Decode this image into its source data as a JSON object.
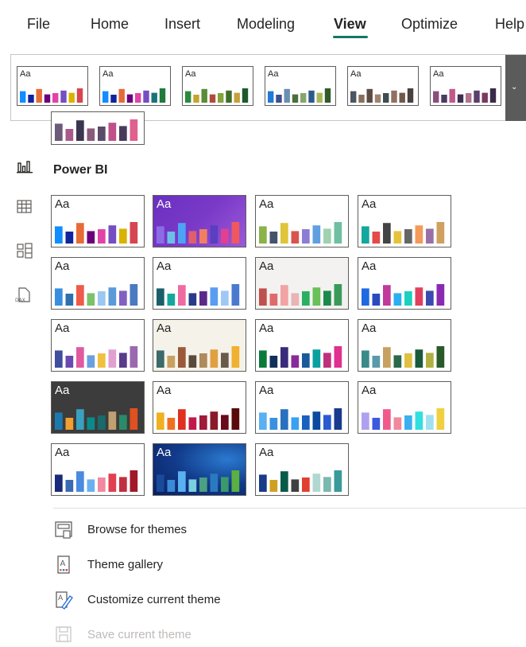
{
  "tabs": [
    {
      "label": "File",
      "active": false
    },
    {
      "label": "Home",
      "active": false
    },
    {
      "label": "Insert",
      "active": false
    },
    {
      "label": "Modeling",
      "active": false
    },
    {
      "label": "View",
      "active": true
    },
    {
      "label": "Optimize",
      "active": false
    },
    {
      "label": "Help",
      "active": false
    }
  ],
  "accent_color": "#117865",
  "aa_label": "Aa",
  "section_title": "Power BI",
  "ribbon_themes": [
    {
      "bars": [
        "#118dff",
        "#12239e",
        "#e66c37",
        "#6b007b",
        "#e044a7",
        "#744ec2",
        "#d9b300",
        "#d64550"
      ]
    },
    {
      "bars": [
        "#118dff",
        "#12239e",
        "#e66c37",
        "#6b007b",
        "#e044a7",
        "#744ec2",
        "#197278",
        "#1e7b3c"
      ]
    },
    {
      "bars": [
        "#2b8a3e",
        "#c6a32b",
        "#5b8c3a",
        "#b24a3c",
        "#84a33b",
        "#3f6e2a",
        "#c7a03a",
        "#1c5a2b"
      ]
    },
    {
      "bars": [
        "#1f7bd4",
        "#3f4e8c",
        "#6a8fb0",
        "#4c6e3d",
        "#85a76b",
        "#2d5a8c",
        "#a7b85b",
        "#325b2b"
      ]
    },
    {
      "bars": [
        "#4b5660",
        "#8a6e5c",
        "#5c4b42",
        "#a08470",
        "#3d4d52",
        "#907060",
        "#6f5a4a",
        "#4a4040"
      ]
    },
    {
      "bars": [
        "#8a4f7d",
        "#4b3b63",
        "#c05a8d",
        "#3d2f52",
        "#b4738d",
        "#5b3f6b",
        "#7a3860",
        "#3a2b4a"
      ]
    }
  ],
  "partial_theme": {
    "bars": [
      "#6b5a7a",
      "#a85a8a",
      "#3a3550",
      "#8a5a7a",
      "#5b4a6a",
      "#c0508a",
      "#4a3a5a",
      "#e06090"
    ]
  },
  "themes": [
    {
      "name": "default",
      "bg": "#ffffff",
      "aa": "#252423",
      "bars": [
        "#118dff",
        "#12239e",
        "#e66c37",
        "#6b007b",
        "#e044a7",
        "#744ec2",
        "#d9b300",
        "#d64550"
      ]
    },
    {
      "name": "purple",
      "bg": "grad-purple",
      "aa": "#ffffff",
      "bars": [
        "#8c6ce6",
        "#6cc0e6",
        "#4da3f5",
        "#e05f6d",
        "#f08060",
        "#5a3fc0",
        "#e04090",
        "#f05860"
      ]
    },
    {
      "name": "natural",
      "bg": "#ffffff",
      "aa": "#252423",
      "bars": [
        "#8ab348",
        "#44546a",
        "#e0c43a",
        "#d9534f",
        "#8c7cd6",
        "#60a0e0",
        "#9fd2ae",
        "#6fc0a0"
      ]
    },
    {
      "name": "teal",
      "bg": "#ffffff",
      "aa": "#252423",
      "bars": [
        "#12a89d",
        "#e44a4a",
        "#444444",
        "#e6c23a",
        "#666666",
        "#f49a5a",
        "#9a6fa8",
        "#d0a060"
      ]
    },
    {
      "name": "frontier",
      "bg": "#ffffff",
      "aa": "#252423",
      "bars": [
        "#3a8ee0",
        "#2f6fb0",
        "#ef5a4a",
        "#7cc26a",
        "#9ac8f0",
        "#5a9ad8",
        "#8060c0",
        "#4a7ac0"
      ]
    },
    {
      "name": "city",
      "bg": "#ffffff",
      "aa": "#252423",
      "bars": [
        "#1a5e6a",
        "#12a89d",
        "#ef6aa0",
        "#2a3a8a",
        "#5a2a8a",
        "#5a9cf0",
        "#a0c8f5",
        "#4a7ad0"
      ]
    },
    {
      "name": "classroom",
      "bg": "#f3f2f1",
      "aa": "#252423",
      "bars": [
        "#c0504d",
        "#e06a6a",
        "#f2a3a3",
        "#e8b4b4",
        "#2ab060",
        "#6ac05a",
        "#1a8a4a",
        "#3a9a5a"
      ]
    },
    {
      "name": "electric",
      "bg": "#ffffff",
      "aa": "#252423",
      "bars": [
        "#1e6ae0",
        "#2a4ac0",
        "#c03a9a",
        "#2ab0f0",
        "#1ad0c0",
        "#e04060",
        "#3a4ab0",
        "#8a2ab0"
      ]
    },
    {
      "name": "executive",
      "bg": "#ffffff",
      "aa": "#252423",
      "bars": [
        "#3f4e9e",
        "#6a4ab0",
        "#e05aa0",
        "#6aa0e0",
        "#f0c040",
        "#e0a0d0",
        "#5a3a8a",
        "#9a6ab0"
      ]
    },
    {
      "name": "highcontrast",
      "bg": "#f5f2ea",
      "aa": "#252423",
      "bars": [
        "#3a6a6a",
        "#c8a060",
        "#9a5a3a",
        "#5a4a3a",
        "#b08a5a",
        "#e0a040",
        "#6a5a4a",
        "#f0b030"
      ]
    },
    {
      "name": "innovate",
      "bg": "#ffffff",
      "aa": "#252423",
      "bars": [
        "#0a7a3a",
        "#12305a",
        "#3a2a7a",
        "#8a2a9a",
        "#1a5a9a",
        "#0aa0a0",
        "#c0307a",
        "#e03090"
      ]
    },
    {
      "name": "bloom",
      "bg": "#ffffff",
      "aa": "#252423",
      "bars": [
        "#3a8a8a",
        "#5a9aaa",
        "#c8a060",
        "#2a6a4a",
        "#e0c040",
        "#1a5a3a",
        "#b0b040",
        "#2a5a2a"
      ]
    },
    {
      "name": "tidal",
      "bg": "#3c3c3c",
      "aa": "#ffffff",
      "bars": [
        "#1a7ab0",
        "#f0a030",
        "#3aa0c0",
        "#0a8a8a",
        "#1a6a6a",
        "#c0a070",
        "#2a8a6a",
        "#e05020"
      ]
    },
    {
      "name": "temperature",
      "bg": "#ffffff",
      "aa": "#252423",
      "bars": [
        "#f0b020",
        "#f07020",
        "#e03020",
        "#c01a4a",
        "#a01a3a",
        "#8a1a2a",
        "#6a0a1a",
        "#5a0a0a"
      ]
    },
    {
      "name": "solar",
      "bg": "#ffffff",
      "aa": "#252423",
      "bars": [
        "#5ab0f0",
        "#3a90e0",
        "#2a70c0",
        "#3aa0f0",
        "#1a60c0",
        "#0a4aa0",
        "#2a5ad0",
        "#1a3a90"
      ]
    },
    {
      "name": "divergent",
      "bg": "#ffffff",
      "aa": "#252423",
      "bars": [
        "#b0a0f0",
        "#3a5ae0",
        "#f05a8a",
        "#f08a9a",
        "#3ab0f0",
        "#30e0e0",
        "#a0e0f0",
        "#f0d040"
      ]
    },
    {
      "name": "storm",
      "bg": "#ffffff",
      "aa": "#252423",
      "bars": [
        "#1a2a7a",
        "#3a6ab0",
        "#4a8ae0",
        "#6ab0f0",
        "#f08aa0",
        "#e04050",
        "#c03040",
        "#a01a2a"
      ]
    },
    {
      "name": "accessible",
      "bg": "grad-blue",
      "aa": "#ffffff",
      "bars": [
        "#1a4a9a",
        "#3a8ad8",
        "#5ab0f0",
        "#7ad0e0",
        "#4aa080",
        "#2a7ac0",
        "#3a9a6a",
        "#5ab040"
      ]
    },
    {
      "name": "sunset",
      "bg": "#ffffff",
      "aa": "#252423",
      "bars": [
        "#1a3a8a",
        "#d0a020",
        "#0a5a4a",
        "#404040",
        "#e04030",
        "#b0d8d0",
        "#7ab8b0",
        "#3a9a9a"
      ]
    }
  ],
  "menu": [
    {
      "label": "Browse for themes",
      "icon": "browse-icon",
      "enabled": true
    },
    {
      "label": "Theme gallery",
      "icon": "theme-gallery-icon",
      "enabled": true
    },
    {
      "label": "Customize current theme",
      "icon": "customize-icon",
      "enabled": true
    },
    {
      "label": "Save current theme",
      "icon": "save-icon",
      "enabled": false
    }
  ],
  "rail_icons": [
    "report-view-icon",
    "table-view-icon",
    "model-view-icon",
    "dax-query-icon"
  ]
}
